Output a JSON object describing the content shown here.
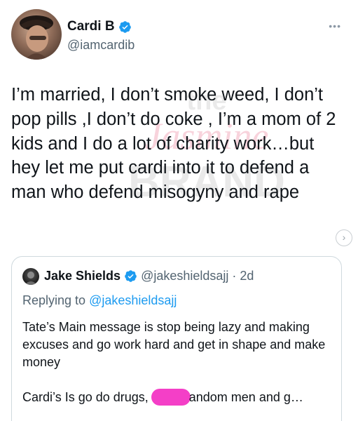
{
  "author": {
    "display_name": "Cardi B",
    "handle": "@iamcardib"
  },
  "more_icon": "•••",
  "tweet_text": "I’m married, I don’t smoke weed, I don’t pop pills ,I don’t do coke , I’m a mom of 2 kids and I do a lot of charity work…but hey let me put cardi into it to defend a man who defend misogyny and rape",
  "watermark": {
    "line1": "the",
    "line2": "Jasmine",
    "line3": "BRAND"
  },
  "quoted_tweet": {
    "display_name": "Jake Shields",
    "handle": "@jakeshieldsajj",
    "separator": "·",
    "time": "2d",
    "replying_prefix": "Replying to ",
    "replying_to": "@jakeshieldsajj",
    "paragraph1": "Tate’s Main message is stop being lazy and making excuses and go work hard and get in shape and make money",
    "paragraph2_before": "Cardi’s Is go do drugs, f",
    "paragraph2_after": "andom men and g…"
  },
  "colors": {
    "verified": "#1d9bf0",
    "link": "#1d9bf0",
    "censor": "#f43fc7",
    "secondary_text": "#536471"
  },
  "icons": {
    "verified": "verified-badge-icon",
    "more": "more-options-icon",
    "next": "chevron-right-icon"
  }
}
